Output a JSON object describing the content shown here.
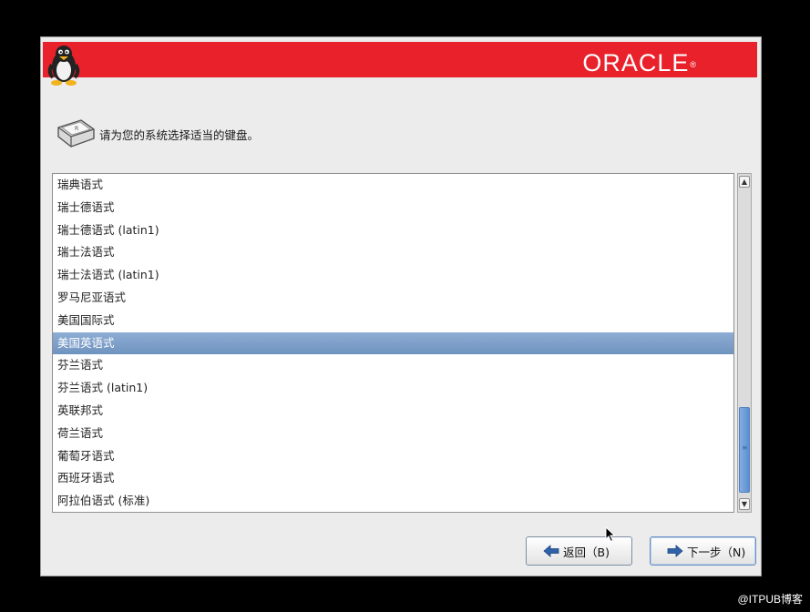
{
  "header": {
    "brand": "ORACLE",
    "brand_mark": "®",
    "banner_color": "#e8212b"
  },
  "prompt": {
    "icon": "keyboard-icon",
    "text": "请为您的系统选择适当的键盘。"
  },
  "keyboard_list": {
    "items": [
      "瑞典语式",
      "瑞士德语式",
      "瑞士德语式 (latin1)",
      "瑞士法语式",
      "瑞士法语式 (latin1)",
      "罗马尼亚语式",
      "美国国际式",
      "美国英语式",
      "芬兰语式",
      "芬兰语式 (latin1)",
      "英联邦式",
      "荷兰语式",
      "葡萄牙语式",
      "西班牙语式",
      "阿拉伯语式 (标准)"
    ],
    "selected": "美国英语式",
    "selection_color": "#7a9cc8"
  },
  "buttons": {
    "back_label": "返回（B)",
    "next_label": "下一步（N)"
  },
  "watermark": "@ITPUB博客"
}
